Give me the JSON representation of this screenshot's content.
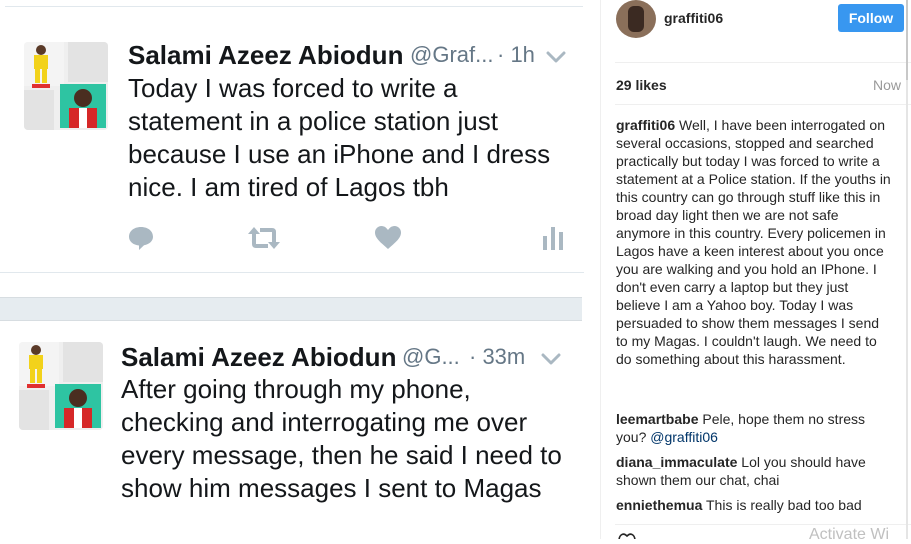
{
  "tweets": [
    {
      "name": "Salami Azeez Abiodun",
      "handle": "@Graf...",
      "time": "· 1h",
      "text": "Today I was forced to write a statement in a police station just because I use an iPhone and I dress nice. I am tired of Lagos tbh"
    },
    {
      "name": "Salami Azeez Abiodun",
      "handle": "@G...",
      "time": "· 33m",
      "text": "After going through my phone, checking and interrogating me over every message, then he said I need to show him messages I sent to Magas"
    }
  ],
  "icons": {
    "reply": "speech-bubble-icon",
    "retweet": "retweet-icon",
    "like": "heart-icon",
    "analytics": "bar-chart-icon"
  },
  "instagram": {
    "username": "graffiti06",
    "follow_label": "Follow",
    "likes": "29 likes",
    "timestamp": "Now",
    "caption_user": "graffiti06",
    "caption_text": "Well, I have been interrogated on several occasions, stopped and searched practically but today I was forced to write a statement at a Police station. If the youths in this country can go through stuff like this in broad day light then we are not safe anymore in this country. Every policemen in Lagos have a keen interest about you once you are walking and you hold an IPhone. I don't even carry a laptop but they just believe I am a Yahoo boy. Today I was persuaded to show them messages I send to my Magas. I couldn't laugh. We need to do something about this harassment.",
    "comments": [
      {
        "user": "leemartbabe",
        "text": "Pele, hope them no stress you?",
        "mention": "@graffiti06"
      },
      {
        "user": "diana_immaculate",
        "text": "Lol you should have shown them our chat, chai",
        "mention": ""
      },
      {
        "user": "enniethemua",
        "text": "This is really bad too bad",
        "mention": ""
      }
    ],
    "watermark": "Activate Wi"
  },
  "colors": {
    "text_dark": "#14171a",
    "text_muted": "#657786",
    "icon_gray": "#aab8c2",
    "follow_blue": "#3897f0",
    "divider": "#e1e8ed"
  }
}
